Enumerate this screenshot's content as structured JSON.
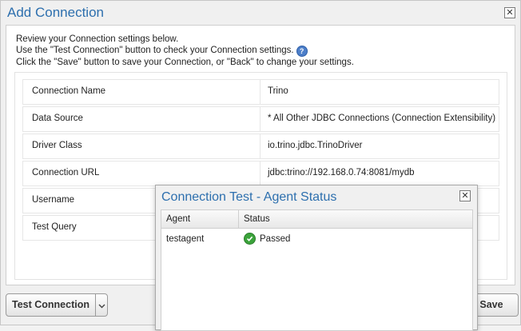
{
  "dialog": {
    "title": "Add Connection",
    "close_symbol": "✕",
    "instructions": {
      "line1": "Review your Connection settings below.",
      "line2": "Use the \"Test Connection\" button to check your Connection settings.",
      "line3": "Click the \"Save\" button to save your Connection, or \"Back\" to change your settings."
    },
    "help_symbol": "?",
    "settings": [
      {
        "label": "Connection Name",
        "value": "Trino"
      },
      {
        "label": "Data Source",
        "value": "* All Other JDBC Connections (Connection Extensibility)"
      },
      {
        "label": "Driver Class",
        "value": "io.trino.jdbc.TrinoDriver"
      },
      {
        "label": "Connection URL",
        "value": "jdbc:trino://192.168.0.74:8081/mydb"
      },
      {
        "label": "Username",
        "value": ""
      },
      {
        "label": "Test Query",
        "value": ""
      }
    ],
    "buttons": {
      "test_connection": "Test Connection",
      "save": "Save"
    }
  },
  "test_dialog": {
    "title": "Connection Test - Agent Status",
    "close_symbol": "✕",
    "columns": {
      "agent": "Agent",
      "status": "Status"
    },
    "rows": [
      {
        "agent": "testagent",
        "status": "Passed"
      }
    ]
  },
  "colors": {
    "title_blue": "#2d6fae",
    "success_green": "#3ba33b",
    "help_blue": "#4d7fc9"
  },
  "icons": {
    "close": "close-icon",
    "help": "help-icon",
    "dropdown": "chevron-down-icon",
    "status_passed": "check-circle-icon"
  }
}
